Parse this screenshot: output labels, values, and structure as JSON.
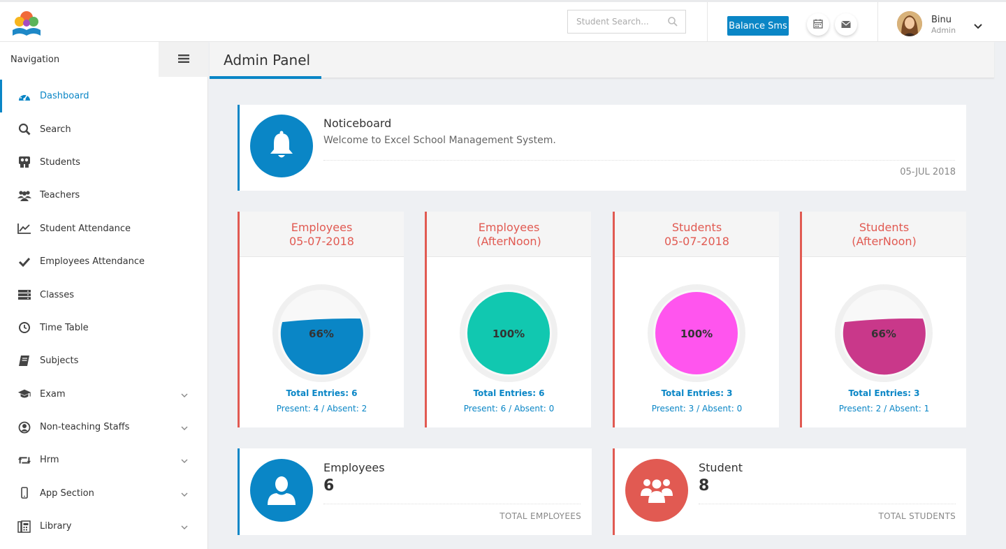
{
  "header": {
    "search_placeholder": "Student Search...",
    "balance_sms_label": "Balance Sms",
    "user_name": "Binu",
    "user_role": "Admin"
  },
  "sidebar": {
    "title": "Navigation",
    "items": [
      {
        "label": "Dashboard",
        "icon": "dashboard-icon",
        "active": true,
        "expandable": false
      },
      {
        "label": "Search",
        "icon": "search-icon",
        "active": false,
        "expandable": false
      },
      {
        "label": "Students",
        "icon": "students-icon",
        "active": false,
        "expandable": false
      },
      {
        "label": "Teachers",
        "icon": "teachers-icon",
        "active": false,
        "expandable": false
      },
      {
        "label": "Student Attendance",
        "icon": "line-chart-icon",
        "active": false,
        "expandable": false
      },
      {
        "label": "Employees Attendance",
        "icon": "check-icon",
        "active": false,
        "expandable": false
      },
      {
        "label": "Classes",
        "icon": "server-icon",
        "active": false,
        "expandable": false
      },
      {
        "label": "Time Table",
        "icon": "clock-icon",
        "active": false,
        "expandable": false
      },
      {
        "label": "Subjects",
        "icon": "book-icon",
        "active": false,
        "expandable": false
      },
      {
        "label": "Exam",
        "icon": "graduation-cap-icon",
        "active": false,
        "expandable": true
      },
      {
        "label": "Non-teaching Staffs",
        "icon": "user-circle-icon",
        "active": false,
        "expandable": true
      },
      {
        "label": "Hrm",
        "icon": "retweet-icon",
        "active": false,
        "expandable": true
      },
      {
        "label": "App Section",
        "icon": "mobile-icon",
        "active": false,
        "expandable": true
      },
      {
        "label": "Library",
        "icon": "library-icon",
        "active": false,
        "expandable": true
      }
    ]
  },
  "panel": {
    "title": "Admin Panel"
  },
  "noticeboard": {
    "title": "Noticeboard",
    "message": "Welcome to Excel School Management System.",
    "date": "05-JUL 2018"
  },
  "stats": [
    {
      "line1": "Employees",
      "line2": "05-07-2018",
      "percent": 66,
      "percent_label": "66%",
      "color": "#0a86c6",
      "total": "Total Entries: 6",
      "present_absent": "Present: 4 / Absent: 2"
    },
    {
      "line1": "Employees",
      "line2": "(AfterNoon)",
      "percent": 100,
      "percent_label": "100%",
      "color": "#11c8b0",
      "total": "Total Entries: 6",
      "present_absent": "Present: 6 / Absent: 0"
    },
    {
      "line1": "Students",
      "line2": "05-07-2018",
      "percent": 100,
      "percent_label": "100%",
      "color": "#ff55ee",
      "total": "Total Entries: 3",
      "present_absent": "Present: 3 / Absent: 0"
    },
    {
      "line1": "Students",
      "line2": "(AfterNoon)",
      "percent": 66,
      "percent_label": "66%",
      "color": "#c9388a",
      "total": "Total Entries: 3",
      "present_absent": "Present: 2 / Absent: 1"
    }
  ],
  "summary": {
    "employees": {
      "title": "Employees",
      "count": "6",
      "label": "TOTAL EMPLOYEES",
      "color": "#0a86c6"
    },
    "students": {
      "title": "Student",
      "count": "8",
      "label": "TOTAL STUDENTS",
      "color": "#e15a52"
    }
  },
  "colors": {
    "accent": "#0a86c6",
    "danger": "#e15a52"
  }
}
